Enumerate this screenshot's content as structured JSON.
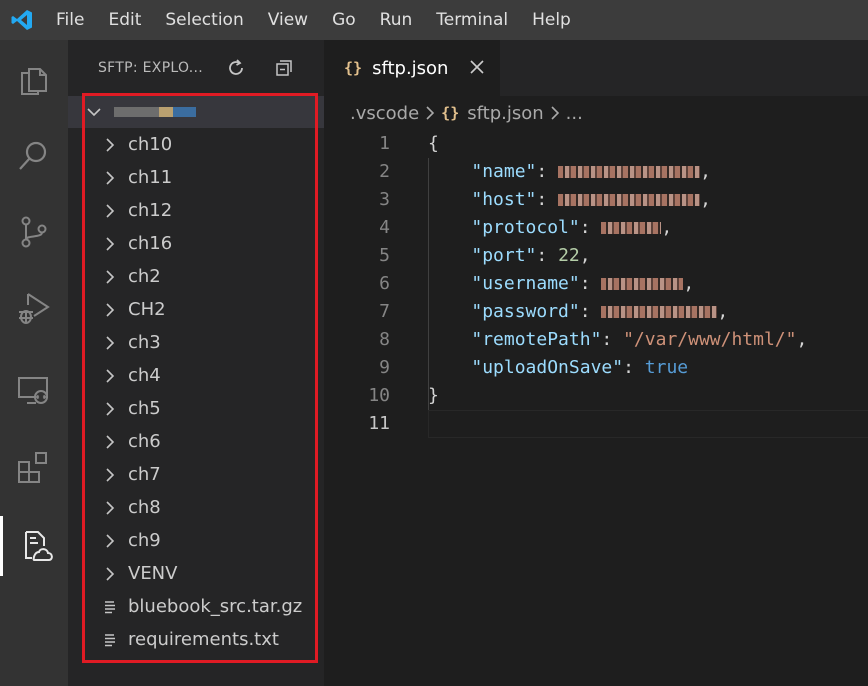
{
  "menu": [
    "File",
    "Edit",
    "Selection",
    "View",
    "Go",
    "Run",
    "Terminal",
    "Help"
  ],
  "activity_icons": [
    "explorer-icon",
    "search-icon",
    "source-control-icon",
    "run-debug-icon",
    "remote-explorer-icon",
    "extensions-icon",
    "sftp-icon"
  ],
  "sidebar": {
    "title": "SFTP: EXPLO...",
    "root_label": "",
    "items": [
      {
        "label": "ch10",
        "type": "folder"
      },
      {
        "label": "ch11",
        "type": "folder"
      },
      {
        "label": "ch12",
        "type": "folder"
      },
      {
        "label": "ch16",
        "type": "folder"
      },
      {
        "label": "ch2",
        "type": "folder"
      },
      {
        "label": "CH2",
        "type": "folder"
      },
      {
        "label": "ch3",
        "type": "folder"
      },
      {
        "label": "ch4",
        "type": "folder"
      },
      {
        "label": "ch5",
        "type": "folder"
      },
      {
        "label": "ch6",
        "type": "folder"
      },
      {
        "label": "ch7",
        "type": "folder"
      },
      {
        "label": "ch8",
        "type": "folder"
      },
      {
        "label": "ch9",
        "type": "folder"
      },
      {
        "label": "VENV",
        "type": "folder"
      },
      {
        "label": "bluebook_src.tar.gz",
        "type": "file"
      },
      {
        "label": "requirements.txt",
        "type": "file"
      }
    ]
  },
  "tab": {
    "label": "sftp.json",
    "brace": "{}"
  },
  "breadcrumb": {
    "folder": ".vscode",
    "file": "sftp.json",
    "more": "..."
  },
  "code": {
    "line_numbers": [
      "1",
      "2",
      "3",
      "4",
      "5",
      "6",
      "7",
      "8",
      "9",
      "10",
      "11"
    ],
    "open_brace": "{",
    "close_brace": "}",
    "name_key": "\"name\"",
    "host_key": "\"host\"",
    "protocol_key": "\"protocol\"",
    "port_key": "\"port\"",
    "port_value": "22",
    "username_key": "\"username\"",
    "password_key": "\"password\"",
    "remotePath_key": "\"remotePath\"",
    "remotePath_value": "\"/var/www/html/\"",
    "uploadOnSave_key": "\"uploadOnSave\"",
    "uploadOnSave_value": "true"
  },
  "colors": {
    "accent_red": "#e01b24",
    "key": "#9cdcfe",
    "string": "#ce9178",
    "number": "#b5cea8",
    "boolean": "#569cd6"
  }
}
